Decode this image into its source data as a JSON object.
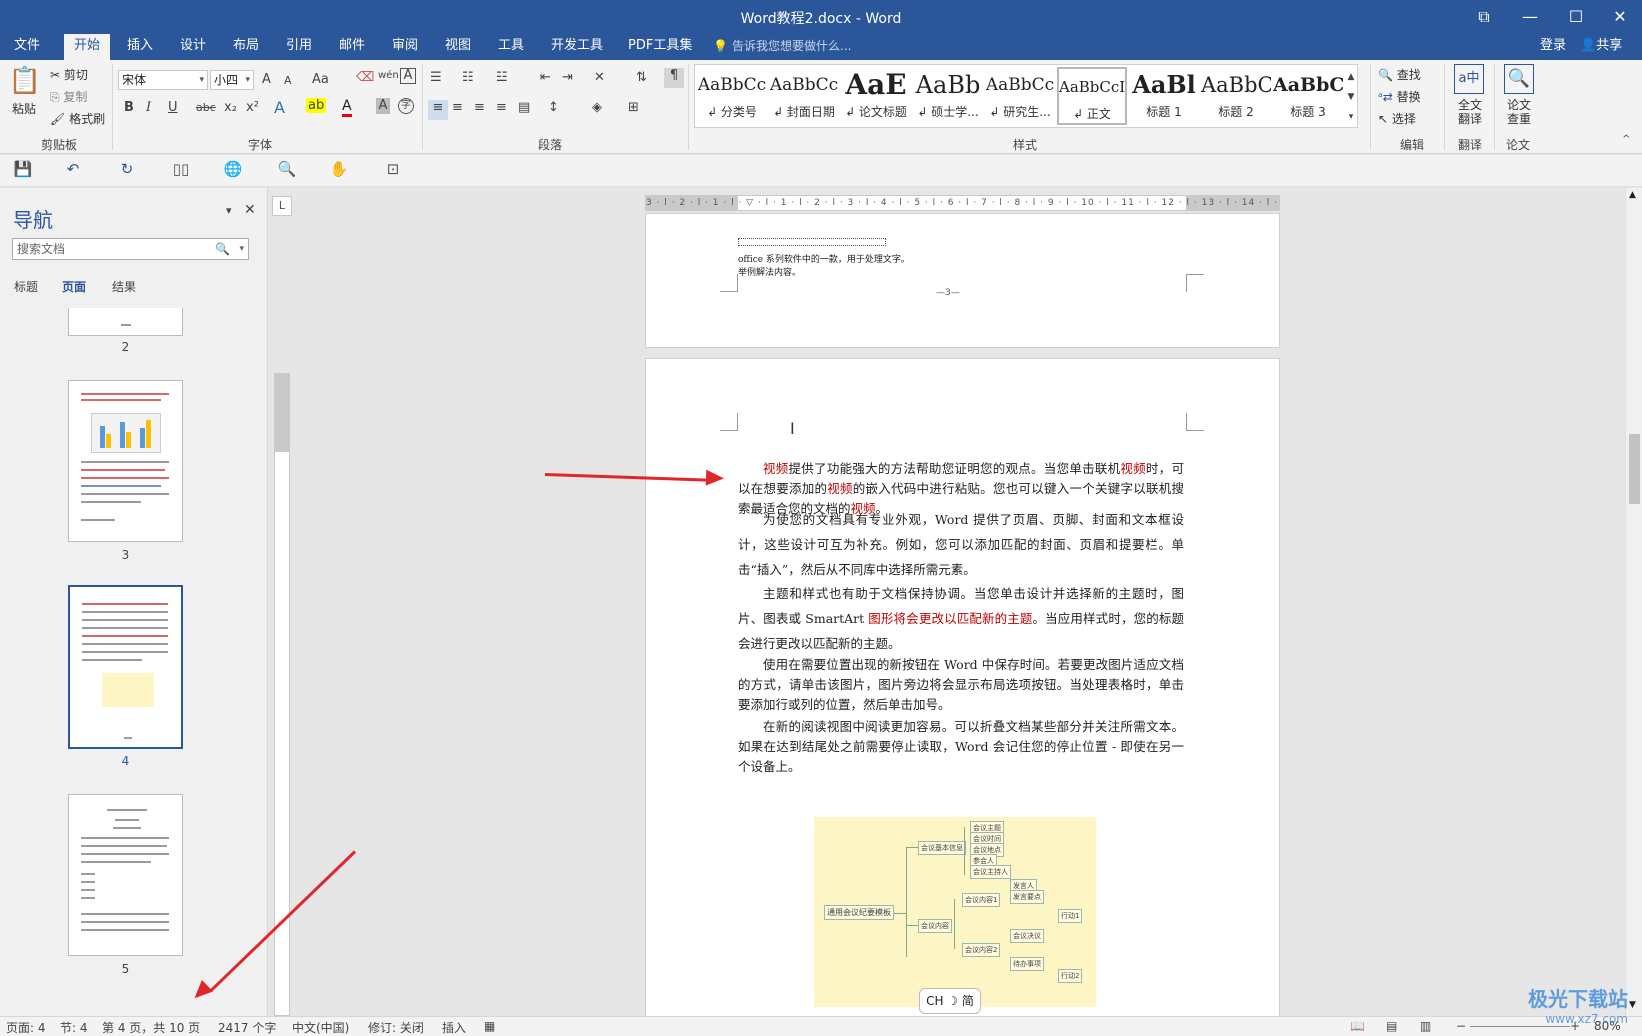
{
  "window": {
    "title": "Word教程2.docx - Word",
    "btn_restore": "⧉",
    "btn_min": "—",
    "btn_max": "☐",
    "btn_close": "✕"
  },
  "menu": {
    "tabs": [
      "文件",
      "开始",
      "插入",
      "设计",
      "布局",
      "引用",
      "邮件",
      "审阅",
      "视图",
      "工具",
      "开发工具",
      "PDF工具集"
    ],
    "active_tab": "开始",
    "tell_me": "告诉我您想要做什么...",
    "login": "登录",
    "share": "共享"
  },
  "ribbon": {
    "clipboard": {
      "paste": "粘贴",
      "cut": "剪切",
      "copy": "复制",
      "format_painter": "格式刷",
      "label": "剪贴板"
    },
    "font": {
      "name": "宋体",
      "size": "小四",
      "label": "字体",
      "grow": "A",
      "shrink": "A",
      "case": "Aa",
      "bold": "B",
      "italic": "I",
      "underline": "U",
      "strike": "abc",
      "sub": "x₂",
      "sup": "x²"
    },
    "paragraph": {
      "label": "段落"
    },
    "styles": {
      "label": "样式",
      "items": [
        {
          "sample": "AaBbCc",
          "name": "↲ 分类号"
        },
        {
          "sample": "AaBbCc",
          "name": "↲ 封面日期"
        },
        {
          "sample": "AaE",
          "name": "↲ 论文标题"
        },
        {
          "sample": "AaBb",
          "name": "↲ 硕士学..."
        },
        {
          "sample": "AaBbCc",
          "name": "↲ 研究生..."
        },
        {
          "sample": "AaBbCcI",
          "name": "↲ 正文"
        },
        {
          "sample": "AaBl",
          "name": "标题 1"
        },
        {
          "sample": "AaBbC",
          "name": "标题 2"
        },
        {
          "sample": "AaBbC",
          "name": "标题 3"
        }
      ],
      "selected": 5
    },
    "editing": {
      "find": "查找",
      "replace": "替换",
      "select": "选择",
      "label": "编辑"
    },
    "translate": {
      "full": "全文翻译",
      "label": "翻译"
    },
    "paper": {
      "check": "论文查重",
      "label": "论文"
    }
  },
  "nav": {
    "title": "导航",
    "search_placeholder": "搜索文档",
    "tabs": [
      "标题",
      "页面",
      "结果"
    ],
    "active_tab": "页面",
    "pages": [
      "2",
      "3",
      "4",
      "5"
    ],
    "selected_page": "4"
  },
  "document": {
    "ruler_top": "3 · l · 2 · l · 1 · l · ▽ · l · 1 · l · 2 · l · 3 · l · 4 · l · 5 · l · 6 · l · 7 · l · 8 · l · 9 · l · 10 · l · 11 · l · 12 · l · 13 · l · 14 · l ·15 · l ·16 · l ·17 · l",
    "prev_page": {
      "line1": "office 系列软件中的一款，用于处理文字。",
      "line2": "举例解法内容。",
      "page_footer": "—3—"
    },
    "paragraphs": [
      {
        "parts": [
          {
            "t": "视频",
            "red": true
          },
          {
            "t": "提供了功能强大的方法帮助您证明您的观点。当您单击联机",
            "red": false
          },
          {
            "t": "视频",
            "red": true
          },
          {
            "t": "时，可以在想要添加的",
            "red": false
          },
          {
            "t": "视频",
            "red": true
          },
          {
            "t": "的嵌入代码中进行粘贴。您也可以键入一个关键字以联机搜索最适合您的文档的",
            "red": false
          },
          {
            "t": "视频",
            "red": true
          },
          {
            "t": "。",
            "red": false
          }
        ]
      },
      {
        "parts": [
          {
            "t": "为使您的文档具有专业外观，Word 提供了页眉、页脚、封面和文本框设计，这些设计可互为补充。例如，您可以添加匹配的封面、页眉和提要栏。单击“插入”，然后从不同库中选择所需元素。",
            "red": false
          }
        ]
      },
      {
        "parts": [
          {
            "t": "主题和样式也有助于文档保持协调。当您单击设计并选择新的主题时，图片、图表或 SmartArt ",
            "red": false
          },
          {
            "t": "图形将会更改以匹配新的主题",
            "red": true
          },
          {
            "t": "。当应用样式时，您的标题会进行更改以匹配新的主题。",
            "red": false
          }
        ]
      },
      {
        "parts": [
          {
            "t": "使用在需要位置出现的新按钮在 Word 中保存时间。若要更改图片适应文档的方式，请单击该图片，图片旁边将会显示布局选项按钮。当处理表格时，单击要添加行或列的位置，然后单击加号。",
            "red": false
          }
        ]
      },
      {
        "parts": [
          {
            "t": "在新的阅读视图中阅读更加容易。可以折叠文档某些部分并关注所需文本。如果在达到结尾处之前需要停止读取，Word 会记住您的停止位置 - 即使在另一个设备上。",
            "red": false
          }
        ]
      }
    ],
    "mindmap": {
      "root": "通用会议纪要模板",
      "nodes": [
        "会议基本信息",
        "会议主题",
        "会议时间",
        "会议地点",
        "参会人",
        "会议主持人",
        "会议内容",
        "会议内容1",
        "发言人",
        "发言要点",
        "会议内容2",
        "会议决议",
        "待办事项",
        "行动1",
        "行动2"
      ]
    },
    "ime": "CH ☽ 简"
  },
  "status": {
    "page": "页面: 4",
    "section": "节: 4",
    "page_of": "第 4 页，共 10 页",
    "words": "2417 个字",
    "language": "中文(中国)",
    "track": "修订: 关闭",
    "mode": "插入",
    "zoom": "80%"
  },
  "watermark": {
    "main": "极光下载站",
    "sub": "www.xz7.com"
  },
  "colors": {
    "brand": "#2b579a",
    "arrow": "#e0262a",
    "red_text": "#c00000"
  }
}
